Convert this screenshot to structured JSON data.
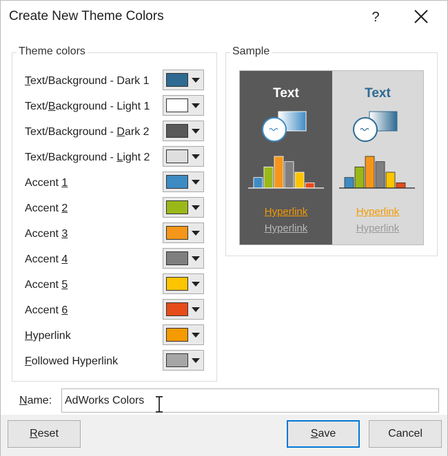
{
  "dialog": {
    "title": "Create New Theme Colors",
    "help_label": "?"
  },
  "theme_colors": {
    "legend": "Theme colors",
    "rows": [
      {
        "pre": "",
        "key": "T",
        "post": "ext/Background - Dark 1",
        "color": "#2e6a92"
      },
      {
        "pre": "Text/",
        "key": "B",
        "post": "ackground - Light 1",
        "color": "#ffffff"
      },
      {
        "pre": "Text/Background - ",
        "key": "D",
        "post": "ark 2",
        "color": "#595959"
      },
      {
        "pre": "Text/Background - ",
        "key": "L",
        "post": "ight 2",
        "color": "#dedede"
      },
      {
        "pre": "Accent ",
        "key": "1",
        "post": "",
        "color": "#3e8bc4"
      },
      {
        "pre": "Accent ",
        "key": "2",
        "post": "",
        "color": "#9ab818"
      },
      {
        "pre": "Accent ",
        "key": "3",
        "post": "",
        "color": "#f5961a"
      },
      {
        "pre": "Accent ",
        "key": "4",
        "post": "",
        "color": "#7f7f7f"
      },
      {
        "pre": "Accent ",
        "key": "5",
        "post": "",
        "color": "#fdc400"
      },
      {
        "pre": "Accent ",
        "key": "6",
        "post": "",
        "color": "#e64c1a"
      },
      {
        "pre": "",
        "key": "H",
        "post": "yperlink",
        "color": "#f59a00"
      },
      {
        "pre": "",
        "key": "F",
        "post": "ollowed Hyperlink",
        "color": "#a6a6a6"
      }
    ]
  },
  "sample": {
    "legend": "Sample",
    "text": "Text",
    "hyperlink": "Hyperlink",
    "followed_hyperlink": "Hyperlink",
    "chart_data": {
      "type": "bar",
      "values": [
        2,
        4,
        6,
        5,
        3,
        1
      ],
      "colors": [
        "#3e8bc4",
        "#9ab818",
        "#f5961a",
        "#7f7f7f",
        "#fdc400",
        "#e64c1a"
      ]
    }
  },
  "name": {
    "label_key": "N",
    "label_rest": "ame:",
    "value": "AdWorks Colors"
  },
  "buttons": {
    "reset_key": "R",
    "reset_rest": "eset",
    "save_key": "S",
    "save_rest": "ave",
    "cancel": "Cancel"
  }
}
